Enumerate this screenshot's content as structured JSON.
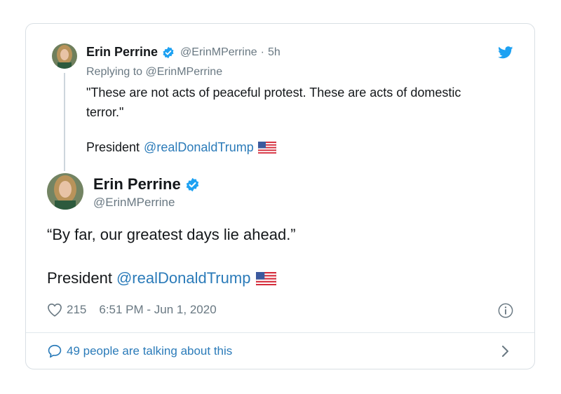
{
  "parent_tweet": {
    "name": "Erin Perrine",
    "handle": "@ErinMPerrine",
    "separator": "·",
    "time_ago": "5h",
    "replying_label": "Replying to",
    "replying_handle": "@ErinMPerrine",
    "text": "\"These are not acts of peaceful protest. These are acts of domestic terror.\"",
    "signature_prefix": "President",
    "signature_mention": "@realDonaldTrump"
  },
  "main_tweet": {
    "name": "Erin Perrine",
    "handle": "@ErinMPerrine",
    "text": "“By far, our greatest days lie ahead.”",
    "signature_prefix": "President",
    "signature_mention": "@realDonaldTrump",
    "likes": "215",
    "timestamp": "6:51 PM - Jun 1, 2020"
  },
  "footer": {
    "talking_text": "49 people are talking about this"
  },
  "icons": {
    "brand": "twitter-bird-icon",
    "verified": "verified-badge-icon",
    "flag": "us-flag-icon",
    "like": "heart-icon",
    "info": "info-icon",
    "reply": "speech-bubble-icon",
    "more": "chevron-right-icon"
  },
  "colors": {
    "brand_blue": "#1da1f2",
    "link_blue": "#2b7bb9",
    "secondary_text": "#697882",
    "border": "#d9dfe4"
  }
}
